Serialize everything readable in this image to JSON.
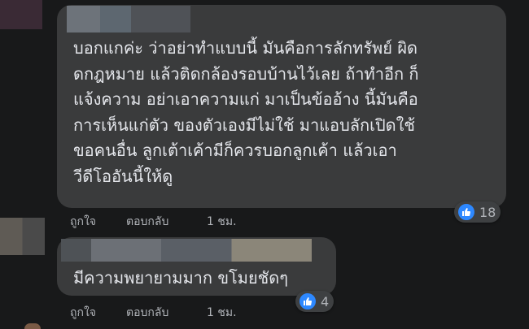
{
  "comment_1": {
    "text": "บอกแกค่ะ ว่าอย่าทำแบบนี้ มันคือการลักทรัพย์ ผิด\nดกฎหมาย แล้วติดกล้องรอบบ้านไว้เลย ถ้าทำอีก ก็\nแจ้งความ อย่าเอาความแก่ มาเป็นข้ออ้าง นี้มันคือ\nการเห็นแก่ตัว ของตัวเองมีไม่ใช้ มาแอบลักเปิดใช้\nขอคนอื่น ลูกเต้าเค้ามีก็ควรบอกลูกเค้า แล้วเอา\nวีดีโออันนี้ให้ดู",
    "like_label": "ถูกใจ",
    "reply_label": "ตอบกลับ",
    "time": "1 ชม.",
    "reaction_count": "18",
    "reaction_icon": "like-icon"
  },
  "comment_2": {
    "text": "มีความพยายามมาก ขโมยชัดๆ",
    "like_label": "ถูกใจ",
    "reply_label": "ตอบกลับ",
    "time": "1 ชม.",
    "reaction_count": "4",
    "reaction_icon": "like-icon"
  },
  "colors": {
    "background": "#18191a",
    "bubble": "#3a3b3c",
    "text": "#e4e6eb",
    "secondary_text": "#b0b3b8",
    "like_blue": "#2d88ff"
  }
}
